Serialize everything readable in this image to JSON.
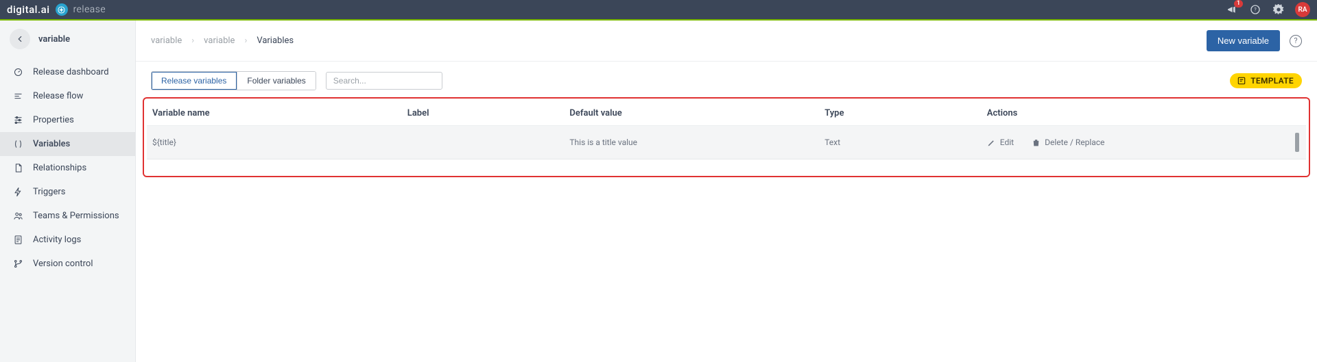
{
  "header": {
    "brand_primary": "digital.ai",
    "brand_secondary": "release",
    "notification_count": "1",
    "avatar_initials": "RA"
  },
  "sidebar": {
    "title": "variable",
    "items": [
      {
        "label": "Release dashboard",
        "icon": "dashboard-icon"
      },
      {
        "label": "Release flow",
        "icon": "flow-icon"
      },
      {
        "label": "Properties",
        "icon": "sliders-icon"
      },
      {
        "label": "Variables",
        "icon": "variable-icon",
        "active": true
      },
      {
        "label": "Relationships",
        "icon": "document-icon"
      },
      {
        "label": "Triggers",
        "icon": "bolt-icon"
      },
      {
        "label": "Teams & Permissions",
        "icon": "people-icon"
      },
      {
        "label": "Activity logs",
        "icon": "log-icon"
      },
      {
        "label": "Version control",
        "icon": "branch-icon"
      }
    ]
  },
  "breadcrumbs": {
    "items": [
      "variable",
      "variable",
      "Variables"
    ]
  },
  "actions": {
    "new_variable": "New variable"
  },
  "tabs": {
    "release": "Release variables",
    "folder": "Folder variables"
  },
  "search": {
    "placeholder": "Search..."
  },
  "template_badge": "TEMPLATE",
  "table": {
    "columns": {
      "name": "Variable name",
      "label": "Label",
      "default": "Default value",
      "type": "Type",
      "actions": "Actions"
    },
    "rows": [
      {
        "name": "${title}",
        "label": "",
        "default": "This is a title value",
        "type": "Text",
        "edit": "Edit",
        "delete": "Delete / Replace"
      }
    ]
  }
}
